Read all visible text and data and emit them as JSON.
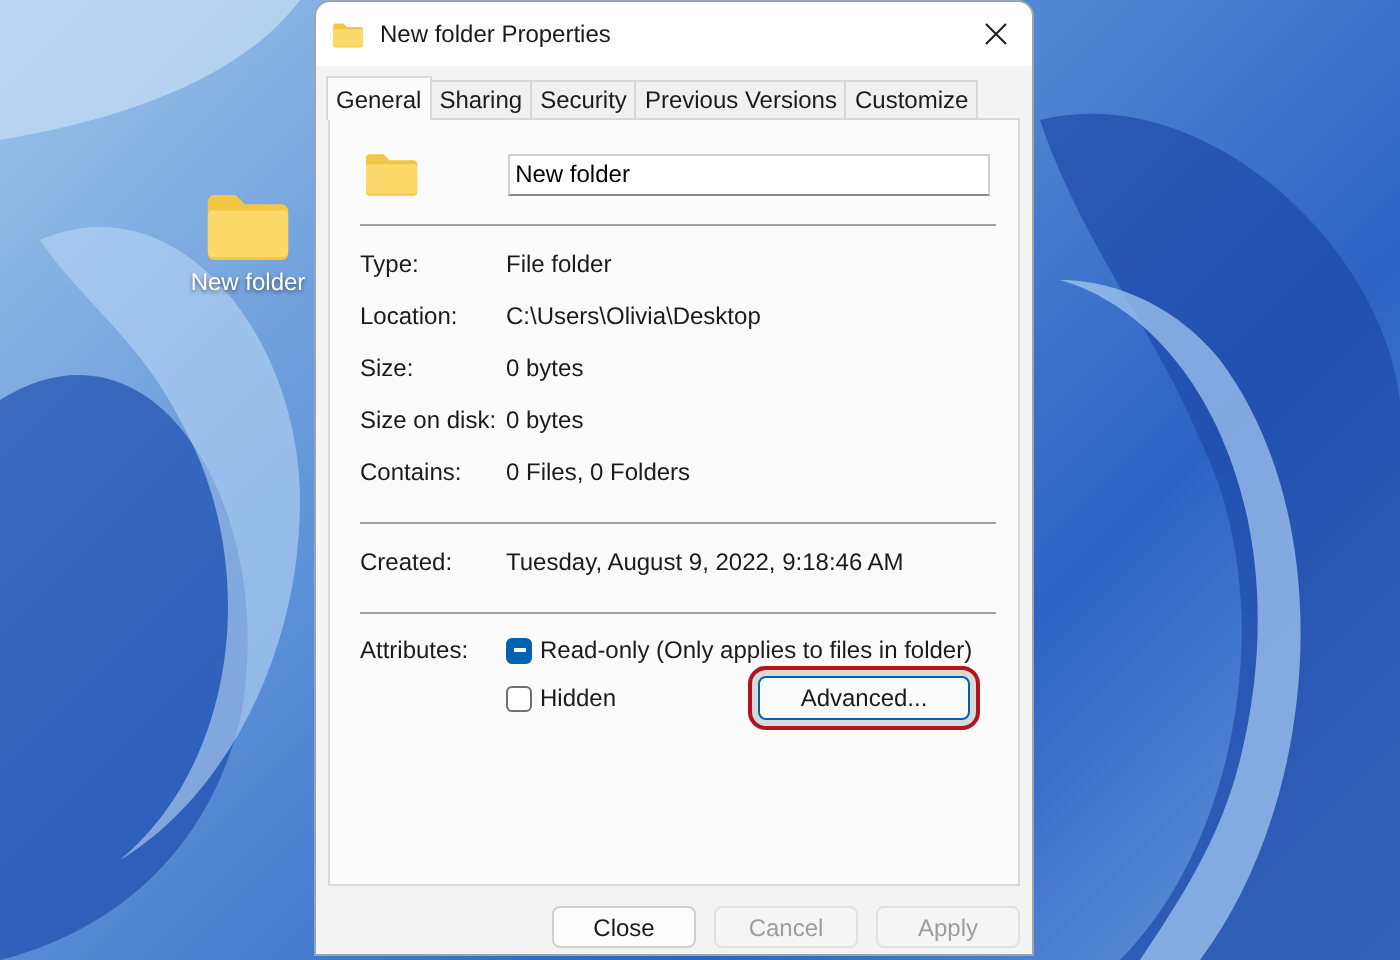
{
  "desktop": {
    "icons": [
      {
        "label": "New folder"
      }
    ]
  },
  "window": {
    "title": "New folder Properties"
  },
  "tabs": [
    {
      "label": "General",
      "selected": true
    },
    {
      "label": "Sharing",
      "selected": false
    },
    {
      "label": "Security",
      "selected": false
    },
    {
      "label": "Previous Versions",
      "selected": false
    },
    {
      "label": "Customize",
      "selected": false
    }
  ],
  "name_field": {
    "value": "New folder"
  },
  "detail_groups": [
    [
      {
        "label": "Type:",
        "value": "File folder"
      },
      {
        "label": "Location:",
        "value": "C:\\Users\\Olivia\\Desktop"
      },
      {
        "label": "Size:",
        "value": "0 bytes"
      },
      {
        "label": "Size on disk:",
        "value": "0 bytes"
      },
      {
        "label": "Contains:",
        "value": "0 Files, 0 Folders"
      }
    ],
    [
      {
        "label": "Created:",
        "value": "Tuesday, August 9, 2022, 9:18:46 AM"
      }
    ]
  ],
  "attributes": {
    "label": "Attributes:",
    "options": [
      {
        "label": "Read-only (Only applies to files in folder)",
        "checked": true,
        "indeterminate": true
      },
      {
        "label": "Hidden",
        "checked": false,
        "indeterminate": false
      }
    ],
    "advanced_button": {
      "label": "Advanced...",
      "highlighted": true
    }
  },
  "buttons": [
    {
      "label": "Close",
      "disabled": false
    },
    {
      "label": "Cancel",
      "disabled": true
    },
    {
      "label": "Apply",
      "disabled": true
    }
  ]
}
